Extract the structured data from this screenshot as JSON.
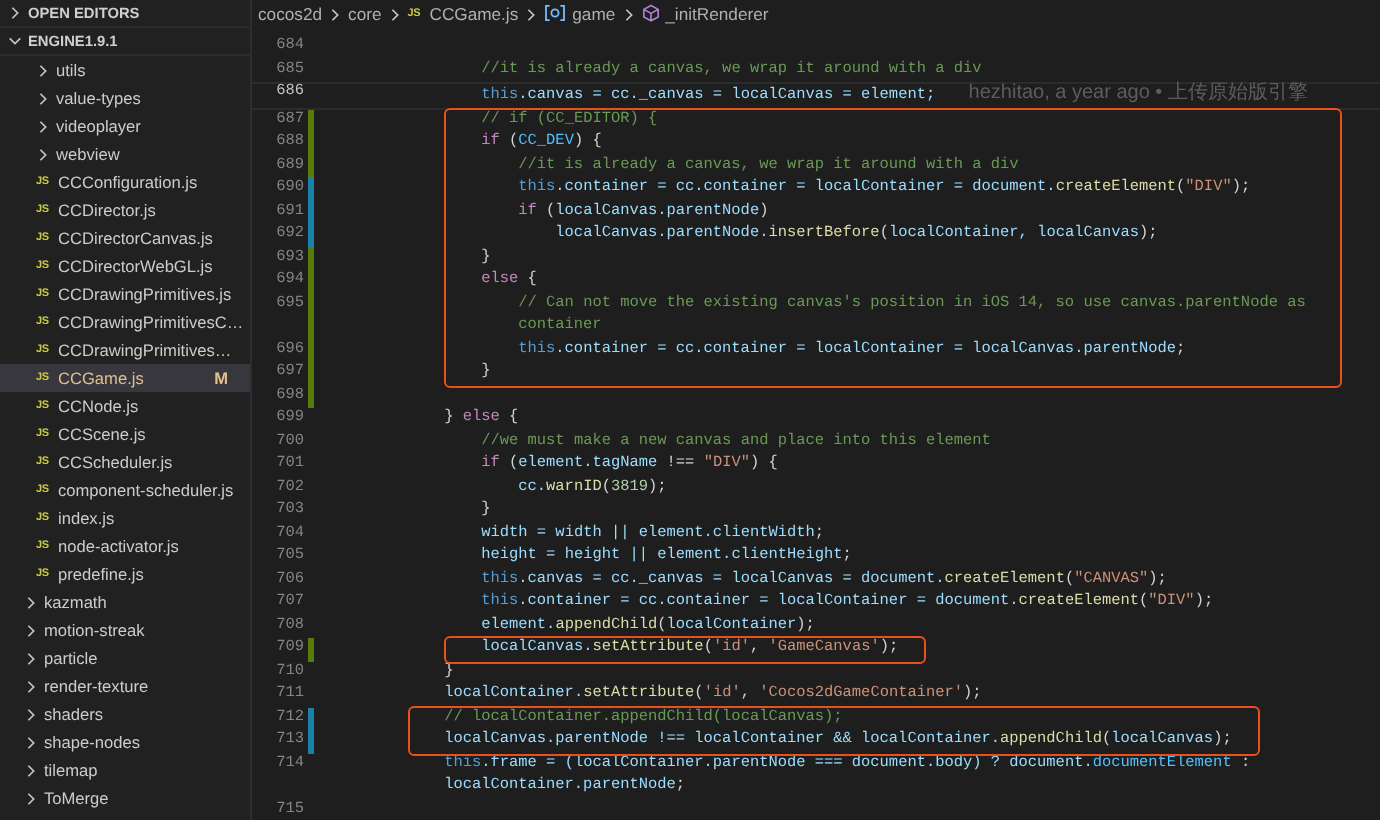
{
  "explorer": {
    "sections": [
      {
        "title": "OPEN EDITORS",
        "expanded": false
      },
      {
        "title": "ENGINE1.9.1",
        "expanded": true,
        "children": [
          {
            "children": [
              {
                "kind": "folder",
                "label": "utils",
                "expanded": false
              },
              {
                "kind": "folder",
                "label": "value-types",
                "expanded": false
              },
              {
                "kind": "folder",
                "label": "videoplayer",
                "expanded": false
              },
              {
                "kind": "folder",
                "label": "webview",
                "expanded": false
              },
              {
                "kind": "file",
                "icon": "JS",
                "label": "CCConfiguration.js",
                "selected": false
              },
              {
                "kind": "file",
                "icon": "JS",
                "label": "CCDirector.js",
                "selected": false
              },
              {
                "kind": "file",
                "icon": "JS",
                "label": "CCDirectorCanvas.js",
                "selected": false
              },
              {
                "kind": "file",
                "icon": "JS",
                "label": "CCDirectorWebGL.js",
                "selected": false
              },
              {
                "kind": "file",
                "icon": "JS",
                "label": "CCDrawingPrimitives.js",
                "selected": false
              },
              {
                "kind": "file",
                "icon": "JS",
                "label": "CCDrawingPrimitivesC…",
                "selected": false
              },
              {
                "kind": "file",
                "icon": "JS",
                "label": "CCDrawingPrimitives…",
                "selected": false
              },
              {
                "kind": "file",
                "icon": "JS",
                "label": "CCGame.js",
                "selected": true,
                "modified": "M"
              },
              {
                "kind": "file",
                "icon": "JS",
                "label": "CCNode.js",
                "selected": false
              },
              {
                "kind": "file",
                "icon": "JS",
                "label": "CCScene.js",
                "selected": false
              },
              {
                "kind": "file",
                "icon": "JS",
                "label": "CCScheduler.js",
                "selected": false
              },
              {
                "kind": "file",
                "icon": "JS",
                "label": "component-scheduler.js",
                "selected": false
              },
              {
                "kind": "file",
                "icon": "JS",
                "label": "index.js",
                "selected": false
              },
              {
                "kind": "file",
                "icon": "JS",
                "label": "node-activator.js",
                "selected": false
              },
              {
                "kind": "file",
                "icon": "JS",
                "label": "predefine.js",
                "selected": false
              }
            ]
          },
          {
            "kind": "folder",
            "label": "kazmath",
            "expanded": false
          },
          {
            "kind": "folder",
            "label": "motion-streak",
            "expanded": false
          },
          {
            "kind": "folder",
            "label": "particle",
            "expanded": false
          },
          {
            "kind": "folder",
            "label": "render-texture",
            "expanded": false
          },
          {
            "kind": "folder",
            "label": "shaders",
            "expanded": false
          },
          {
            "kind": "folder",
            "label": "shape-nodes",
            "expanded": false
          },
          {
            "kind": "folder",
            "label": "tilemap",
            "expanded": false
          },
          {
            "kind": "folder",
            "label": "ToMerge",
            "expanded": false
          }
        ]
      }
    ]
  },
  "breadcrumb": [
    {
      "kind": "folder",
      "label": "cocos2d"
    },
    {
      "kind": "folder",
      "label": "core"
    },
    {
      "kind": "file",
      "icon": "JS",
      "label": "CCGame.js"
    },
    {
      "kind": "variable",
      "label": "game"
    },
    {
      "kind": "method",
      "label": "_initRenderer"
    }
  ],
  "code": {
    "blocks": [
      {
        "boxed": false,
        "lines": [
          {
            "number": "684",
            "current": false
          },
          {
            "number": "685",
            "current": false,
            "segments": [
              {
                "kind": "comment",
                "text": "                //it is already a canvas, we wrap it around with a div"
              }
            ]
          },
          {
            "number": "686",
            "current": true,
            "blame": "hezhitao, a year ago • 上传原始版引擎",
            "segments": [
              {
                "kind": "this",
                "text": "                this"
              },
              {
                "kind": "variable",
                "text": ".canvas = cc._canvas = localCanvas = element;"
              }
            ]
          }
        ]
      },
      {
        "boxed": true,
        "lines": [
          {
            "number": "687",
            "current": false,
            "color": "#587c0c",
            "segments": [
              {
                "kind": "comment",
                "text": "                // if (CC_EDITOR) {"
              }
            ]
          },
          {
            "number": "688",
            "current": false,
            "color": "#587c0c",
            "segments": [
              {
                "kind": "keyword",
                "text": "                if"
              },
              {
                "kind": "plain",
                "text": " ("
              },
              {
                "kind": "constant",
                "text": "CC_DEV"
              },
              {
                "kind": "plain",
                "text": ") {"
              }
            ]
          },
          {
            "number": "689",
            "current": false,
            "color": "#587c0c",
            "segments": [
              {
                "kind": "comment",
                "text": "                    //it is already a canvas, we wrap it around with a div"
              }
            ]
          },
          {
            "number": "690",
            "current": false,
            "color": "#1b81a8",
            "segments": [
              {
                "kind": "this",
                "text": "                    this"
              },
              {
                "kind": "variable",
                "text": ".container = cc.container = localContainer = document."
              },
              {
                "kind": "function",
                "text": "createElement"
              },
              {
                "kind": "plain",
                "text": "("
              },
              {
                "kind": "string",
                "text": "\"DIV\""
              },
              {
                "kind": "plain",
                "text": ");"
              }
            ]
          },
          {
            "number": "691",
            "current": false,
            "color": "#1b81a8",
            "segments": [
              {
                "kind": "keyword",
                "text": "                    if"
              },
              {
                "kind": "plain",
                "text": " ("
              },
              {
                "kind": "variable",
                "text": "localCanvas.parentNode"
              },
              {
                "kind": "plain",
                "text": ")"
              }
            ]
          },
          {
            "number": "692",
            "current": false,
            "color": "#1b81a8",
            "segments": [
              {
                "kind": "variable",
                "text": "                        localCanvas.parentNode."
              },
              {
                "kind": "function",
                "text": "insertBefore"
              },
              {
                "kind": "plain",
                "text": "("
              },
              {
                "kind": "variable",
                "text": "localContainer, localCanvas"
              },
              {
                "kind": "plain",
                "text": ");"
              }
            ]
          },
          {
            "number": "693",
            "current": false,
            "color": "#587c0c",
            "segments": [
              {
                "kind": "plain",
                "text": "                }"
              }
            ]
          },
          {
            "number": "694",
            "current": false,
            "color": "#587c0c",
            "segments": [
              {
                "kind": "keyword",
                "text": "                else"
              },
              {
                "kind": "plain",
                "text": " {"
              }
            ]
          },
          {
            "number": "695",
            "current": false,
            "color": "#587c0c",
            "segments": [
              {
                "kind": "comment",
                "text": "                    // Can not move the existing canvas's position in iOS 14, so use canvas.parentNode as container"
              }
            ]
          },
          {
            "number": "696",
            "current": false,
            "color": "#587c0c",
            "segments": [
              {
                "kind": "this",
                "text": "                    this"
              },
              {
                "kind": "variable",
                "text": ".container = cc.container = localContainer = localCanvas.parentNode"
              },
              {
                "kind": "plain",
                "text": ";"
              }
            ]
          },
          {
            "number": "697",
            "current": false,
            "color": "#587c0c",
            "segments": [
              {
                "kind": "plain",
                "text": "                }"
              }
            ]
          }
        ]
      },
      {
        "boxed": false,
        "lines": [
          {
            "number": "698",
            "current": false,
            "color": "#587c0c"
          },
          {
            "number": "699",
            "current": false,
            "segments": [
              {
                "kind": "plain",
                "text": "            } "
              },
              {
                "kind": "keyword",
                "text": "else"
              },
              {
                "kind": "plain",
                "text": " {"
              }
            ]
          },
          {
            "number": "700",
            "current": false,
            "segments": [
              {
                "kind": "comment",
                "text": "                //we must make a new canvas and place into this element"
              }
            ]
          },
          {
            "number": "701",
            "current": false,
            "segments": [
              {
                "kind": "keyword",
                "text": "                if"
              },
              {
                "kind": "plain",
                "text": " ("
              },
              {
                "kind": "variable",
                "text": "element.tagName"
              },
              {
                "kind": "plain",
                "text": " !== "
              },
              {
                "kind": "string",
                "text": "\"DIV\""
              },
              {
                "kind": "plain",
                "text": ") {"
              }
            ]
          },
          {
            "number": "702",
            "current": false,
            "segments": [
              {
                "kind": "variable",
                "text": "                    cc."
              },
              {
                "kind": "function",
                "text": "warnID"
              },
              {
                "kind": "plain",
                "text": "("
              },
              {
                "kind": "number",
                "text": "3819"
              },
              {
                "kind": "plain",
                "text": ");"
              }
            ]
          },
          {
            "number": "703",
            "current": false,
            "segments": [
              {
                "kind": "plain",
                "text": "                }"
              }
            ]
          },
          {
            "number": "704",
            "current": false,
            "segments": [
              {
                "kind": "variable",
                "text": "                width = width || element.clientWidth"
              },
              {
                "kind": "plain",
                "text": ";"
              }
            ]
          },
          {
            "number": "705",
            "current": false,
            "segments": [
              {
                "kind": "variable",
                "text": "                height = height || element.clientHeight"
              },
              {
                "kind": "plain",
                "text": ";"
              }
            ]
          },
          {
            "number": "706",
            "current": false,
            "segments": [
              {
                "kind": "this",
                "text": "                this"
              },
              {
                "kind": "variable",
                "text": ".canvas = cc._canvas = localCanvas = document."
              },
              {
                "kind": "function",
                "text": "createElement"
              },
              {
                "kind": "plain",
                "text": "("
              },
              {
                "kind": "string",
                "text": "\"CANVAS\""
              },
              {
                "kind": "plain",
                "text": ");"
              }
            ]
          },
          {
            "number": "707",
            "current": false,
            "segments": [
              {
                "kind": "this",
                "text": "                this"
              },
              {
                "kind": "variable",
                "text": ".container = cc.container = localContainer = document."
              },
              {
                "kind": "function",
                "text": "createElement"
              },
              {
                "kind": "plain",
                "text": "("
              },
              {
                "kind": "string",
                "text": "\"DIV\""
              },
              {
                "kind": "plain",
                "text": ");"
              }
            ]
          },
          {
            "number": "708",
            "current": false,
            "segments": [
              {
                "kind": "variable",
                "text": "                element."
              },
              {
                "kind": "function",
                "text": "appendChild"
              },
              {
                "kind": "plain",
                "text": "("
              },
              {
                "kind": "variable",
                "text": "localContainer"
              },
              {
                "kind": "plain",
                "text": ");"
              }
            ]
          }
        ]
      },
      {
        "boxed": true,
        "lines": [
          {
            "number": "709",
            "current": false,
            "color": "#587c0c",
            "segments": [
              {
                "kind": "variable",
                "text": "                localCanvas."
              },
              {
                "kind": "function",
                "text": "setAttribute"
              },
              {
                "kind": "plain",
                "text": "("
              },
              {
                "kind": "string",
                "text": "'id'"
              },
              {
                "kind": "plain",
                "text": ", "
              },
              {
                "kind": "string",
                "text": "'GameCanvas'"
              },
              {
                "kind": "plain",
                "text": ");"
              }
            ]
          }
        ]
      },
      {
        "boxed": false,
        "lines": [
          {
            "number": "710",
            "current": false,
            "segments": [
              {
                "kind": "plain",
                "text": "            }"
              }
            ]
          },
          {
            "number": "711",
            "current": false,
            "segments": [
              {
                "kind": "variable",
                "text": "            localContainer."
              },
              {
                "kind": "function",
                "text": "setAttribute"
              },
              {
                "kind": "plain",
                "text": "("
              },
              {
                "kind": "string",
                "text": "'id'"
              },
              {
                "kind": "plain",
                "text": ", "
              },
              {
                "kind": "string",
                "text": "'Cocos2dGameContainer'"
              },
              {
                "kind": "plain",
                "text": ");"
              }
            ]
          }
        ]
      },
      {
        "boxed": true,
        "lines": [
          {
            "number": "712",
            "current": false,
            "color": "#1b81a8",
            "segments": [
              {
                "kind": "comment",
                "text": "            // localContainer.appendChild(localCanvas);"
              }
            ]
          },
          {
            "number": "713",
            "current": false,
            "color": "#1b81a8",
            "segments": [
              {
                "kind": "variable",
                "text": "            localCanvas.parentNode !== localContainer && localContainer."
              },
              {
                "kind": "function",
                "text": "appendChild"
              },
              {
                "kind": "plain",
                "text": "("
              },
              {
                "kind": "variable",
                "text": "localCanvas"
              },
              {
                "kind": "plain",
                "text": ");"
              }
            ]
          }
        ]
      },
      {
        "boxed": false,
        "lines": [
          {
            "number": "714",
            "current": false,
            "segments": [
              {
                "kind": "this",
                "text": "            this"
              },
              {
                "kind": "variable",
                "text": ".frame = (localContainer.parentNode === document.body) ? document."
              },
              {
                "kind": "constant",
                "text": "documentElement"
              },
              {
                "kind": "plain",
                "text": " : "
              },
              {
                "kind": "variable",
                "text": "localContainer.parentNode"
              },
              {
                "kind": "plain",
                "text": ";"
              }
            ]
          },
          {
            "number": "715",
            "current": false
          }
        ]
      }
    ]
  }
}
